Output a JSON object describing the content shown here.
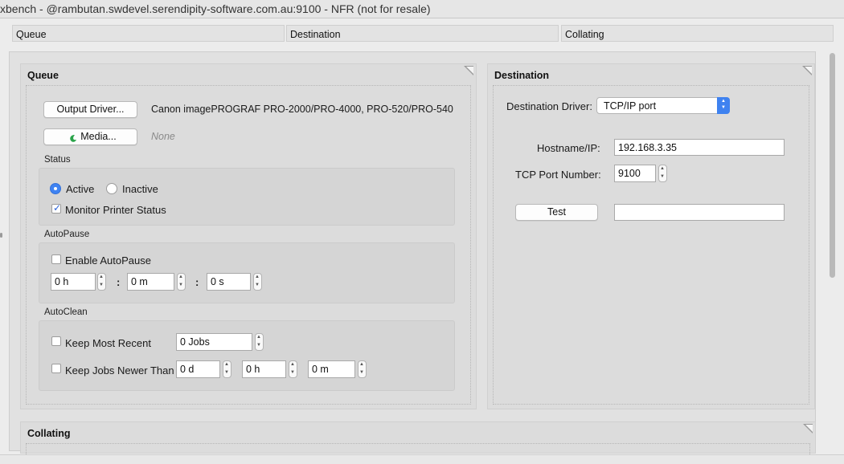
{
  "window": {
    "title": "xbench - @rambutan.swdevel.serendipity-software.com.au:9100 - NFR (not for resale)"
  },
  "tabs": [
    "Queue",
    "Destination",
    "Collating"
  ],
  "queue": {
    "title": "Queue",
    "output_driver_button": "Output Driver...",
    "driver_name": "Canon imagePROGRAF PRO-2000/PRO-4000, PRO-520/PRO-540",
    "media_button": "Media...",
    "media_value": "None",
    "status": {
      "label": "Status",
      "active_label": "Active",
      "inactive_label": "Inactive",
      "selected": "Active",
      "monitor_label": "Monitor Printer Status",
      "monitor_checked": true
    },
    "autopause": {
      "label": "AutoPause",
      "enable_label": "Enable AutoPause",
      "enabled": false,
      "hours": "0 h",
      "minutes": "0 m",
      "seconds": "0 s",
      "separator": ":"
    },
    "autoclean": {
      "label": "AutoClean",
      "keep_recent_label": "Keep Most Recent",
      "keep_recent_checked": false,
      "jobs": "0 Jobs",
      "keep_newer_label": "Keep Jobs Newer Than",
      "keep_newer_checked": false,
      "days": "0 d",
      "hours": "0 h",
      "minutes": "0 m"
    }
  },
  "destination": {
    "title": "Destination",
    "driver_label": "Destination Driver:",
    "driver_value": "TCP/IP port",
    "hostname_label": "Hostname/IP:",
    "hostname_value": "192.168.3.35",
    "port_label": "TCP Port Number:",
    "port_value": "9100",
    "test_button": "Test",
    "test_result": ""
  },
  "collating": {
    "title": "Collating"
  },
  "colors": {
    "accent": "#3f83f2",
    "panel_bg": "#dcdcdc",
    "window_bg": "#ececec"
  }
}
